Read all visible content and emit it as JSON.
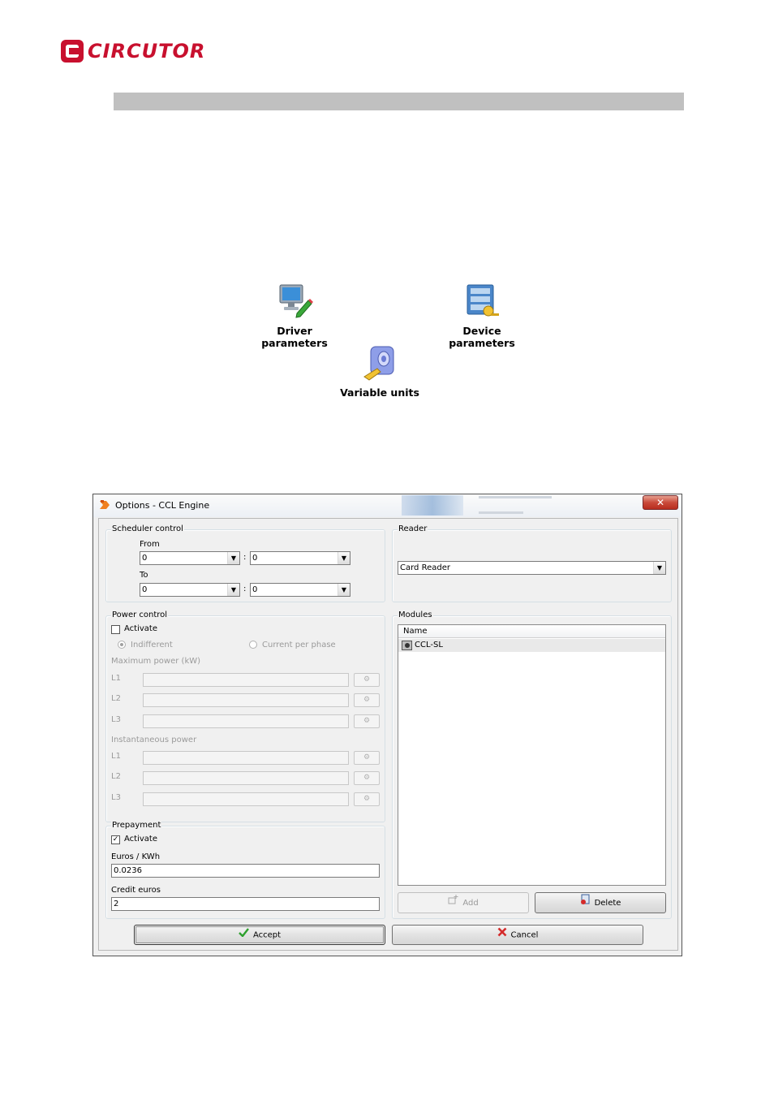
{
  "brand": {
    "name": "CIRCUTOR"
  },
  "tools": [
    {
      "label": "Driver parameters",
      "icon": "monitor-pen-icon"
    },
    {
      "label": "Device parameters",
      "icon": "database-key-icon"
    },
    {
      "label": "Variable units",
      "icon": "unit-disc-icon"
    }
  ],
  "dialog": {
    "title": "Options - CCL Engine",
    "close_label": "✕",
    "scheduler": {
      "label": "Scheduler control",
      "from_label": "From",
      "to_label": "To",
      "separator": ":",
      "from_hour": "0",
      "from_min": "0",
      "to_hour": "0",
      "to_min": "0"
    },
    "reader": {
      "label": "Reader",
      "selected": "Card Reader"
    },
    "power": {
      "label": "Power control",
      "activate_label": "Activate",
      "activate_checked": false,
      "radio_indifferent": "Indifferent",
      "radio_current": "Current per phase",
      "max_power_label": "Maximum power (kW)",
      "inst_power_label": "Instantaneous power",
      "phases": [
        "L1",
        "L2",
        "L3"
      ]
    },
    "modules": {
      "label": "Modules",
      "column": "Name",
      "rows": [
        "CCL-SL"
      ],
      "add_label": "Add",
      "delete_label": "Delete"
    },
    "prepayment": {
      "label": "Prepayment",
      "activate_label": "Activate",
      "activate_checked": true,
      "euros_label": "Euros / KWh",
      "euros_value": "0.0236",
      "credit_label": "Credit euros",
      "credit_value": "2"
    },
    "accept_label": "Accept",
    "cancel_label": "Cancel"
  }
}
